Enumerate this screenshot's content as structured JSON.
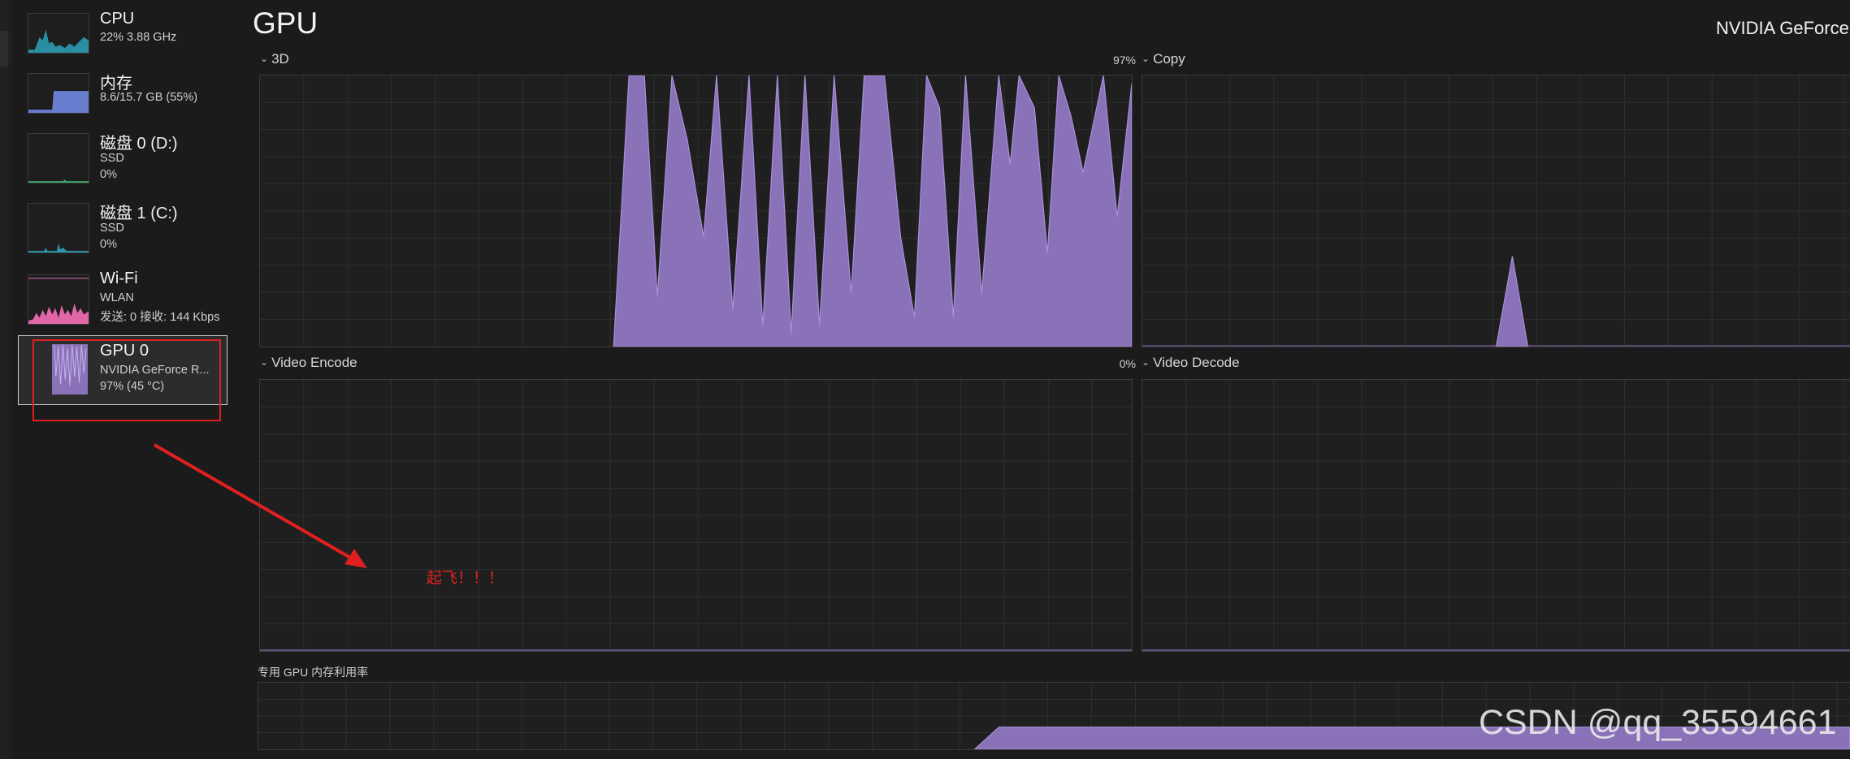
{
  "sidebar": {
    "items": [
      {
        "name": "CPU",
        "sub1": "22%  3.88 GHz",
        "sub2": ""
      },
      {
        "name": "内存",
        "sub1": "8.6/15.7 GB (55%)",
        "sub2": ""
      },
      {
        "name": "磁盘 0 (D:)",
        "sub1": "SSD",
        "sub2": "0%"
      },
      {
        "name": "磁盘 1 (C:)",
        "sub1": "SSD",
        "sub2": "0%"
      },
      {
        "name": "Wi-Fi",
        "sub1": "WLAN",
        "sub2": "发送: 0 接收: 144 Kbps"
      },
      {
        "name": "GPU 0",
        "sub1": "NVIDIA GeForce R...",
        "sub2": "97%  (45 °C)"
      }
    ],
    "selected": "GPU 0"
  },
  "header": {
    "title": "GPU",
    "device": "NVIDIA GeForce R"
  },
  "graphs": {
    "g3d": {
      "label": "3D",
      "value": "97%"
    },
    "copy": {
      "label": "Copy",
      "value": ""
    },
    "encode": {
      "label": "Video Encode",
      "value": "0%"
    },
    "decode": {
      "label": "Video Decode",
      "value": ""
    }
  },
  "memory": {
    "label": "专用 GPU 内存利用率"
  },
  "annotation": {
    "text": "起飞！！！",
    "color": "#e02020"
  },
  "watermark": "CSDN @qq_35594661",
  "colors": {
    "background": "#1b1b1b",
    "gpu_fill": "#8a72b8",
    "gpu_stroke": "#a890d8",
    "cpu_fill": "#2a9ab0",
    "mem_fill": "#6a7ed0",
    "wifi_fill": "#e066a8",
    "annotation": "#e02020"
  }
}
